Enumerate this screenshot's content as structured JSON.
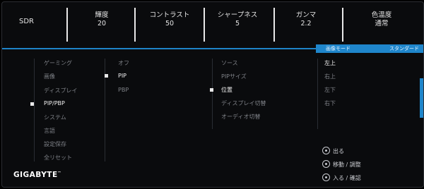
{
  "status_bar": {
    "dynamic_range": "SDR",
    "brightness": {
      "label": "輝度",
      "value": "20"
    },
    "contrast": {
      "label": "コントラスト",
      "value": "50"
    },
    "sharpness": {
      "label": "シャープネス",
      "value": "5"
    },
    "gamma": {
      "label": "ガンマ",
      "value": "2.2"
    },
    "color_temp": {
      "label": "色温度",
      "value": "通常"
    }
  },
  "mode_tab": {
    "label": "画像モード",
    "value": "スタンダード"
  },
  "main_menu": [
    {
      "label": "ゲーミング",
      "active": false
    },
    {
      "label": "画像",
      "active": false
    },
    {
      "label": "ディスプレイ",
      "active": false
    },
    {
      "label": "PIP/PBP",
      "active": true
    },
    {
      "label": "システム",
      "active": false
    },
    {
      "label": "言語",
      "active": false
    },
    {
      "label": "設定保存",
      "active": false
    },
    {
      "label": "全リセット",
      "active": false
    }
  ],
  "pip_mode": [
    {
      "label": "オフ",
      "active": false
    },
    {
      "label": "PIP",
      "active": true
    },
    {
      "label": "PBP",
      "active": false
    }
  ],
  "pip_settings": [
    {
      "label": "ソース",
      "active": false
    },
    {
      "label": "PIPサイズ",
      "active": false
    },
    {
      "label": "位置",
      "active": true
    },
    {
      "label": "ディスプレイ切替",
      "active": false
    },
    {
      "label": "オーディオ切替",
      "active": false
    }
  ],
  "position_options": [
    {
      "label": "左上",
      "active": true
    },
    {
      "label": "右上",
      "active": false
    },
    {
      "label": "左下",
      "active": false
    },
    {
      "label": "右下",
      "active": false
    }
  ],
  "hints": {
    "exit": "出る",
    "move": "移動",
    "adjust": "/ 調整",
    "enter": "入る",
    "confirm": "/ 確認"
  },
  "brand": "GIGABYTE"
}
